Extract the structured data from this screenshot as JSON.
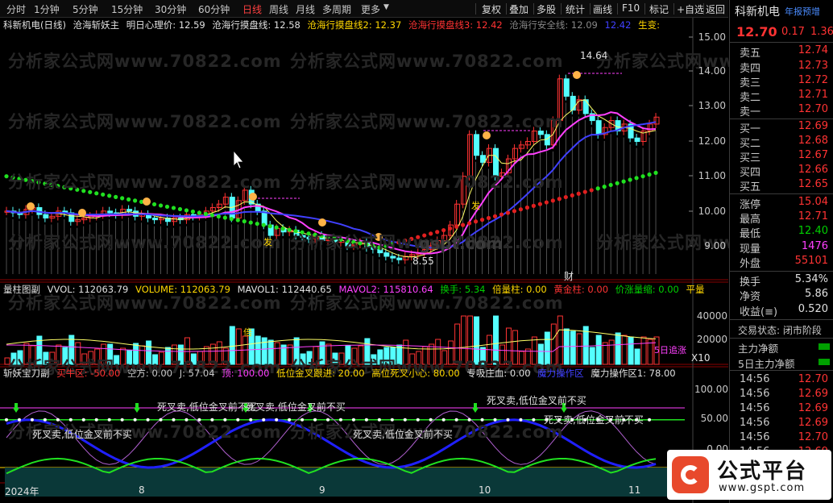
{
  "toolbar": {
    "tabs": [
      "分时",
      "1分钟",
      "5分钟",
      "15分钟",
      "30分钟",
      "60分钟",
      "日线",
      "周线",
      "月线",
      "多周期",
      "更多"
    ],
    "active_tab": "日线",
    "buttons": [
      "复权",
      "叠加",
      "多股",
      "统计",
      "画线",
      "F10",
      "标记",
      "+自选",
      "返回"
    ]
  },
  "main_legend": {
    "title": "科新机电(日线)",
    "indicator": "沧海斩妖主",
    "items": [
      {
        "text": "明日心理价: 12.59",
        "color": "#e0e0e0"
      },
      {
        "text": "沧海行摸盘线: 12.58",
        "color": "#e0e0e0"
      },
      {
        "text": "沧海行摸盘线2: 12.37",
        "color": "#ffd700"
      },
      {
        "text": "沧海行摸盘线3: 12.42",
        "color": "#ff3333"
      },
      {
        "text": "沧海行安全线: 12.09",
        "color": "#888888"
      },
      {
        "text": "12.42",
        "color": "#4040ff"
      },
      {
        "text": "生变:",
        "color": "#ffd700"
      }
    ]
  },
  "price_axis": [
    "15.00",
    "14.00",
    "13.00",
    "12.00",
    "11.00",
    "10.00",
    "9.00"
  ],
  "annotations": {
    "high": "14.64",
    "low": "8.55",
    "cai": "财",
    "fa1": "发",
    "fa2": "发"
  },
  "vol_legend": {
    "title": "量柱图副",
    "items": [
      {
        "text": "VVOL: 112063.79",
        "color": "#e0e0e0"
      },
      {
        "text": "VOLUME: 112063.79",
        "color": "#ffd700"
      },
      {
        "text": "MAVOL1: 112440.65",
        "color": "#e0e0e0"
      },
      {
        "text": "MAVOL2: 115810.64",
        "color": "#ff40ff"
      },
      {
        "text": "换手: 5.34",
        "color": "#00d000"
      },
      {
        "text": "倍量柱: 0.00",
        "color": "#ffd700"
      },
      {
        "text": "黄金柱: 0.00",
        "color": "#ff3333"
      },
      {
        "text": "价涨量缩: 0.00",
        "color": "#00d000"
      },
      {
        "text": "平量",
        "color": "#ffd700"
      }
    ]
  },
  "vol_axis": [
    "40000",
    "20000"
  ],
  "vol_unit": "X10",
  "vol_labels": {
    "bei": "倍",
    "five_day": "5日追涨"
  },
  "ind_legend": {
    "title": "斩妖宝刀副",
    "items": [
      {
        "text": "买牛区: -50.00",
        "color": "#ff3333"
      },
      {
        "text": "空方: 0.00",
        "color": "#c8c8c8"
      },
      {
        "text": "J: 57.04",
        "color": "#c8c8c8"
      },
      {
        "text": "顶: 100.00",
        "color": "#ff40ff"
      },
      {
        "text": "低位金叉跟进: 20.00",
        "color": "#ffd700"
      },
      {
        "text": "高位死叉小心: 80.00",
        "color": "#ffd700"
      },
      {
        "text": "专吸庄血: 0.00",
        "color": "#e0e0e0"
      },
      {
        "text": "魔力操作区",
        "color": "#4040ff"
      },
      {
        "text": "魔力操作区1: 78.00",
        "color": "#e0e0e0"
      }
    ]
  },
  "ind_axis": [
    "100.00",
    "50.00",
    "0.00"
  ],
  "ind_texts": [
    "死叉卖,低位金叉前不买",
    "死叉卖,低位金叉前不买",
    "死叉卖,低位金叉前不买",
    "死叉卖,低位金叉前不买",
    "死叉卖,低位金叉前不买",
    "死叉卖,低位金叉前不买"
  ],
  "date_axis": [
    "2024年",
    "8",
    "9",
    "10",
    "11"
  ],
  "watermark": "分析家公式网www.70822.com",
  "gspt_text": "gspt.com",
  "right_panel": {
    "name": "科新机电",
    "report_link": "年报预增",
    "price": "12.70",
    "change": "0.17",
    "change_pct": "1.36",
    "sells": [
      {
        "label": "卖五",
        "value": "12.74"
      },
      {
        "label": "卖四",
        "value": "12.73"
      },
      {
        "label": "卖三",
        "value": "12.72"
      },
      {
        "label": "卖二",
        "value": "12.71"
      },
      {
        "label": "卖一",
        "value": "12.70"
      }
    ],
    "buys": [
      {
        "label": "买一",
        "value": "12.69"
      },
      {
        "label": "买二",
        "value": "12.68"
      },
      {
        "label": "买三",
        "value": "12.67"
      },
      {
        "label": "买四",
        "value": "12.66"
      },
      {
        "label": "买五",
        "value": "12.65"
      }
    ],
    "stats1": [
      {
        "label": "涨停",
        "value": "15.04",
        "color": "#ff3333"
      },
      {
        "label": "最高",
        "value": "12.71",
        "color": "#ff3333"
      },
      {
        "label": "最低",
        "value": "12.40",
        "color": "#00d000"
      },
      {
        "label": "现量",
        "value": "1476",
        "color": "#ff40ff"
      },
      {
        "label": "外盘",
        "value": "55101",
        "color": "#ff3333"
      }
    ],
    "stats2": [
      {
        "label": "换手",
        "value": "5.34%",
        "color": "#e0e0e0"
      },
      {
        "label": "净资",
        "value": "5.86",
        "color": "#e0e0e0"
      },
      {
        "label": "收益(≡)",
        "value": "0.520",
        "color": "#e0e0e0"
      }
    ],
    "trade_status_label": "交易状态:",
    "trade_status_value": "闭市阶段",
    "fund1": "主力净额",
    "fund2": "5日主力净额",
    "ticks": [
      {
        "time": "14:56",
        "price": "12.70"
      },
      {
        "time": "14:56",
        "price": "12.69"
      },
      {
        "time": "14:56",
        "price": "12.69"
      },
      {
        "time": "14:56",
        "price": "12.69"
      },
      {
        "time": "14:56",
        "price": "12.70"
      },
      {
        "time": "14:56",
        "price": "12.69"
      }
    ]
  },
  "logo": {
    "text": "公式平台",
    "url": "www.gspt.com"
  }
}
